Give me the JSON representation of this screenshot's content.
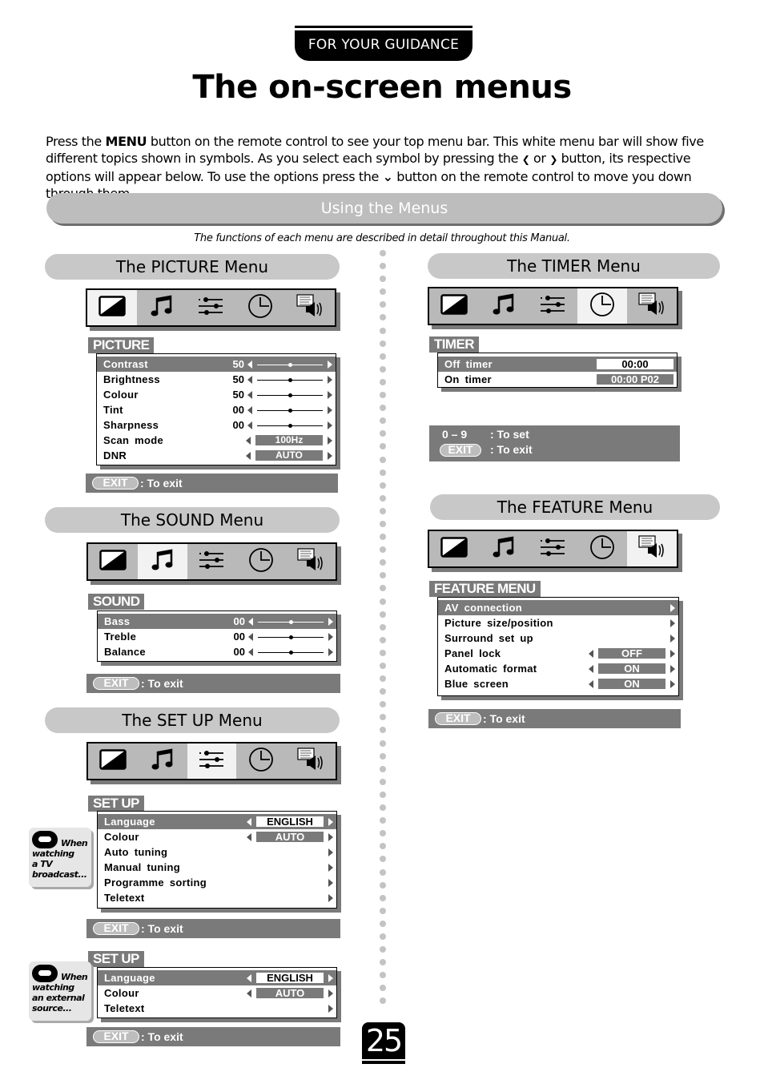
{
  "header": {
    "tab": "FOR YOUR GUIDANCE",
    "title": "The on-screen menus"
  },
  "intro": {
    "p1": "Press the ",
    "menu_word": "MENU",
    "p2": " button on the remote control to see your top menu bar. This white menu bar will show five different topics shown in symbols. As you select each symbol by pressing the ",
    "left_glyph": "❮",
    "or": " or ",
    "right_glyph": "❯",
    "p3": " button, its respective options will appear below. To use the options press the ",
    "down_glyph": "⌄",
    "p4": " button on the remote control to move you down through them."
  },
  "banner": "Using the Menus",
  "subnote": "The functions of each menu are described in detail throughout this Manual.",
  "icons": [
    "picture-icon",
    "sound-note-icon",
    "setup-sliders-icon",
    "timer-clock-icon",
    "feature-teletext-speaker-icon"
  ],
  "exit": {
    "key": "EXIT",
    "label": ": To exit"
  },
  "picture": {
    "heading": "The PICTURE Menu",
    "selected_icon": 0,
    "tag": "PICTURE",
    "rows": [
      {
        "label": "Contrast",
        "value": "50",
        "slider": 0.5
      },
      {
        "label": "Brightness",
        "value": "50",
        "slider": 0.5
      },
      {
        "label": "Colour",
        "value": "50",
        "slider": 0.5
      },
      {
        "label": "Tint",
        "value": "00",
        "slider": 0.5
      },
      {
        "label": "Sharpness",
        "value": "00",
        "slider": 0.5
      },
      {
        "label": "Scan mode",
        "option": "100Hz"
      },
      {
        "label": "DNR",
        "option": "AUTO"
      }
    ]
  },
  "sound": {
    "heading": "The SOUND Menu",
    "selected_icon": 1,
    "tag": "SOUND",
    "rows": [
      {
        "label": "Bass",
        "value": "00",
        "slider": 0.5
      },
      {
        "label": "Treble",
        "value": "00",
        "slider": 0.5
      },
      {
        "label": "Balance",
        "value": "00",
        "slider": 0.5
      }
    ]
  },
  "setup": {
    "heading": "The SET UP Menu",
    "selected_icon": 2,
    "tag": "SET UP",
    "tv_note": "When watching a TV broadcast...",
    "tv_note_lines": [
      "When",
      "watching",
      "a TV",
      "broadcast..."
    ],
    "tv_rows": [
      {
        "label": "Language",
        "option": "ENGLISH"
      },
      {
        "label": "Colour",
        "option": "AUTO"
      },
      {
        "label": "Auto  tuning"
      },
      {
        "label": "Manual  tuning"
      },
      {
        "label": "Programme  sorting"
      },
      {
        "label": "Teletext"
      }
    ],
    "ext_note_lines": [
      "When",
      "watching",
      "an external",
      "source..."
    ],
    "ext_rows": [
      {
        "label": "Language",
        "option": "ENGLISH"
      },
      {
        "label": "Colour",
        "option": "AUTO"
      },
      {
        "label": "Teletext"
      }
    ]
  },
  "timer": {
    "heading": "The TIMER Menu",
    "selected_icon": 3,
    "tag": "TIMER",
    "rows": [
      {
        "label": "Off  timer",
        "option": "00:00"
      },
      {
        "label": "On  timer",
        "option": "00:00  P02"
      }
    ],
    "help": [
      {
        "key": "0 – 9",
        "label": ": To set"
      },
      {
        "key": "EXIT",
        "label": ": To exit"
      }
    ]
  },
  "feature": {
    "heading": "The FEATURE Menu",
    "selected_icon": 4,
    "tag": "FEATURE MENU",
    "rows": [
      {
        "label": "AV  connection"
      },
      {
        "label": "Picture  size/position"
      },
      {
        "label": "Surround  set  up"
      },
      {
        "label": "Panel  lock",
        "option": "OFF"
      },
      {
        "label": "Automatic  format",
        "option": "ON"
      },
      {
        "label": "Blue  screen",
        "option": "ON"
      }
    ]
  },
  "page_number": "25"
}
